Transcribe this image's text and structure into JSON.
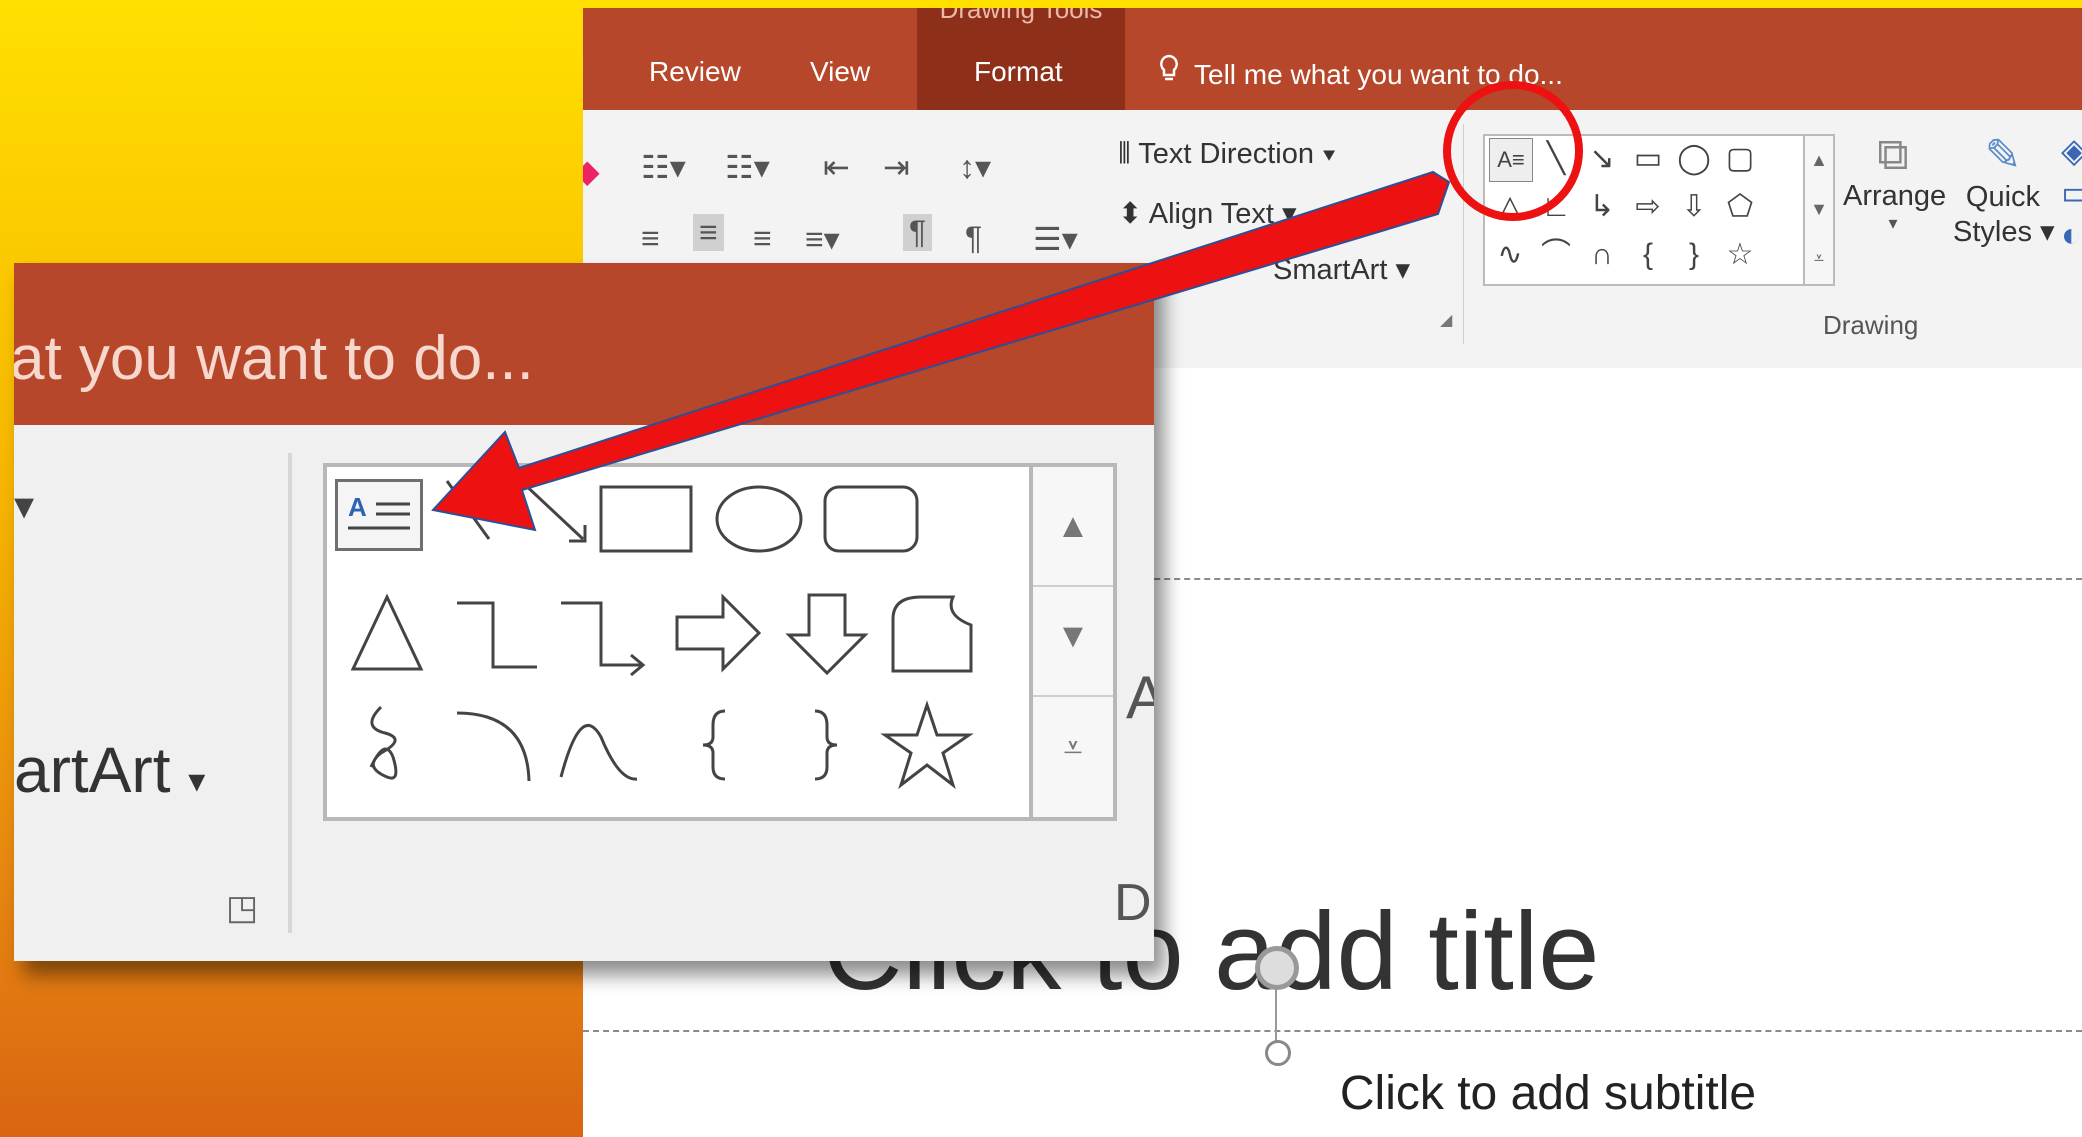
{
  "ribbon": {
    "context_group_label": "Drawing Tools",
    "tabs": [
      {
        "label": "Review"
      },
      {
        "label": "View"
      },
      {
        "label": "Format"
      }
    ],
    "tell_me": "Tell me what you want to do...",
    "paragraph": {
      "text_direction": "Text Direction",
      "align_text": "Align Text",
      "convert_smartart": "SmartArt"
    },
    "drawing": {
      "arrange": "Arrange",
      "quick": "Quick",
      "styles": "Styles",
      "group_label": "Drawing"
    }
  },
  "slide": {
    "title_placeholder": "Click to add title",
    "subtitle_placeholder": "Click to add subtitle"
  },
  "zoom": {
    "tell_me_fragment": "at you want to do...",
    "smartart_fragment": "artArt",
    "drawing_fragment": "D",
    "align_fragment": "A"
  },
  "colors": {
    "ribbon_red": "#b7472a",
    "context_group": "#8e2f19",
    "annotation_red": "#ee1111"
  }
}
